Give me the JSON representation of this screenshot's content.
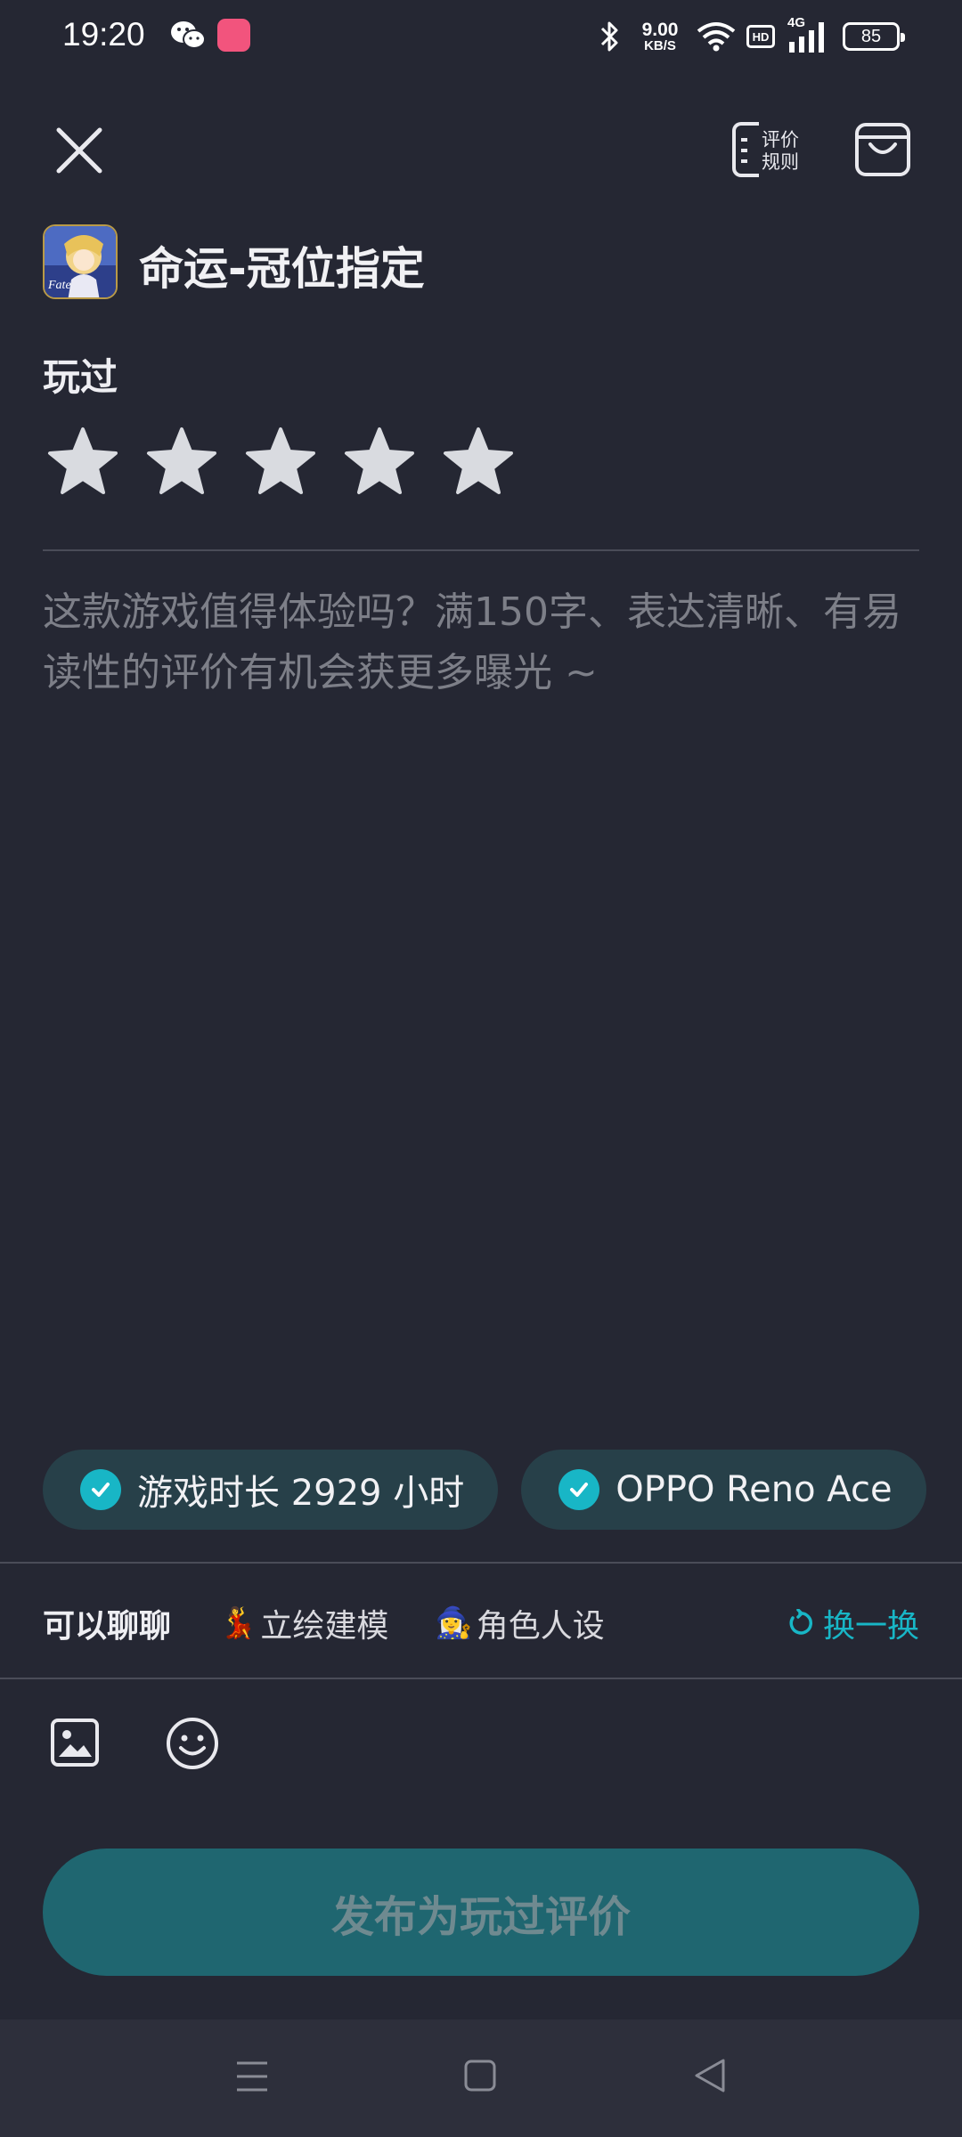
{
  "status_bar": {
    "time": "19:20",
    "speed_value": "9.00",
    "speed_unit": "KB/S",
    "hd": "HD",
    "network": "4G",
    "battery": "85"
  },
  "header": {
    "close_icon": "close-icon",
    "rules_label_line1": "评价",
    "rules_label_line2": "规则",
    "bag_icon": "bag-icon"
  },
  "game": {
    "title": "命运-冠位指定",
    "icon_text": "Fate"
  },
  "rating": {
    "label": "玩过",
    "stars_total": 5,
    "stars_selected": 0
  },
  "review": {
    "placeholder": "这款游戏值得体验吗？满150字、表达清晰、有易读性的评价有机会获更多曝光 ~",
    "value": ""
  },
  "chips": [
    {
      "label": "游戏时长 2929 小时",
      "checked": true
    },
    {
      "label": "OPPO Reno Ace",
      "checked": true
    }
  ],
  "talk": {
    "label": "可以聊聊",
    "topics": [
      {
        "emoji": "💃",
        "label": "立绘建模"
      },
      {
        "emoji": "🧙‍♀️",
        "label": "角色人设"
      }
    ],
    "refresh_label": "换一换"
  },
  "toolbar": {
    "image_icon": "image-icon",
    "emoji_icon": "emoji-icon"
  },
  "publish_label": "发布为玩过评价",
  "colors": {
    "background": "#252733",
    "accent": "#18b6c6",
    "publish_button": "#1f6670",
    "chip_background": "#274049"
  }
}
